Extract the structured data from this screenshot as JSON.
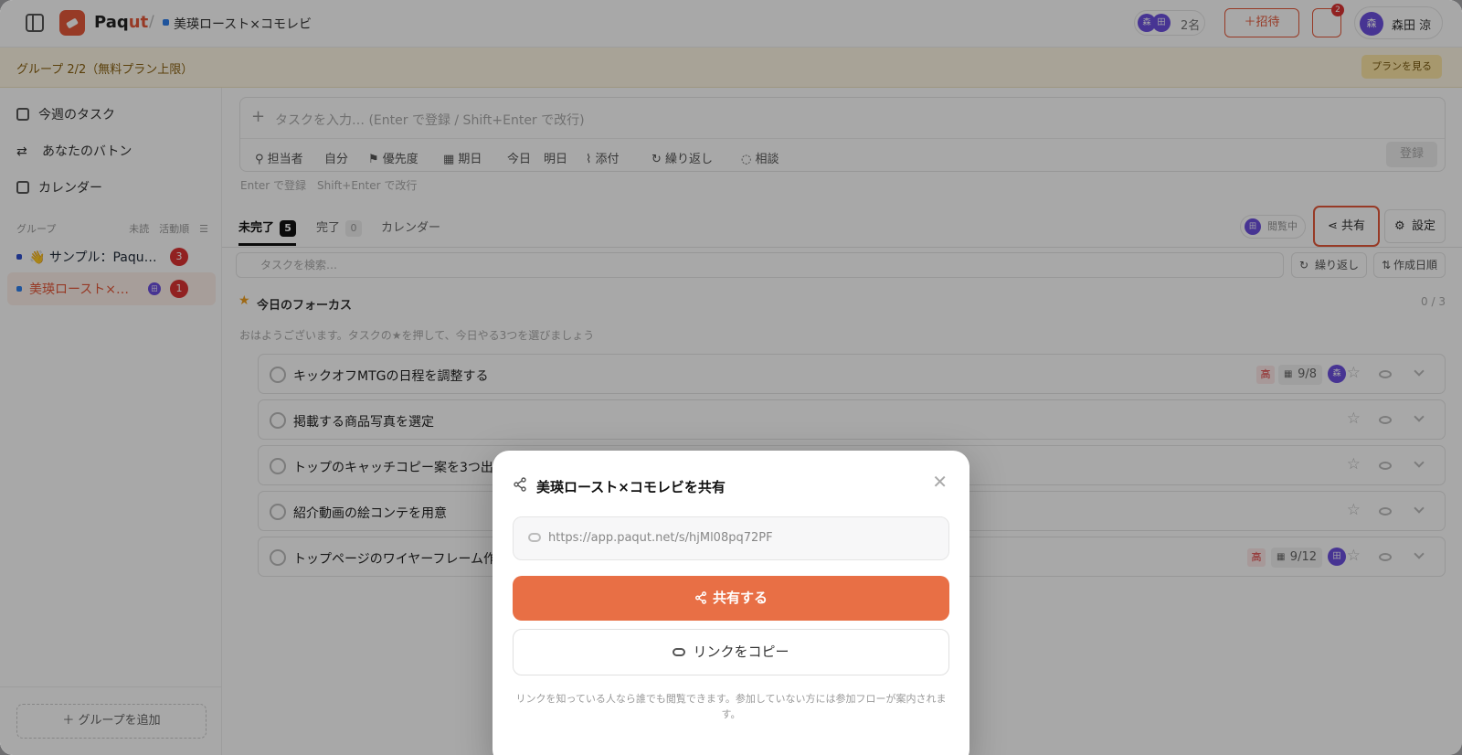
{
  "header": {
    "brand_prefix": "Paq",
    "brand_suffix": "ut",
    "breadcrumb": "美瑛ロースト×コモレビ",
    "member_avatars": [
      "森",
      "田"
    ],
    "member_count": "2名",
    "invite_label": "＋招待",
    "notification_count": "2",
    "user_avatar": "森",
    "user_name": "森田 涼"
  },
  "banner": {
    "text": "グループ 2/2（無料プラン上限）",
    "button": "プランを見る"
  },
  "sidebar": {
    "nav": [
      "今週のタスク",
      "あなたのバトン",
      "カレンダー"
    ],
    "group_header": "グループ",
    "group_header_right": [
      "未読",
      "活動順"
    ],
    "groups": [
      {
        "label": "👋 サンプル：Paqu…",
        "badge": "3",
        "color": "#2f4fcf"
      },
      {
        "label": "美瑛ロースト×…",
        "badge": "1",
        "avatar": "田",
        "color": "#2f80ed"
      }
    ],
    "add_group": "＋ グループを追加"
  },
  "composer": {
    "placeholder": "タスクを入力… (Enter で登録 / Shift+Enter で改行)",
    "tools": [
      "担当者",
      "自分",
      "優先度",
      "期日",
      "今日",
      "明日",
      "添付",
      "繰り返し",
      "相談"
    ],
    "register": "登録",
    "hint": "Enter で登録　Shift+Enter で改行"
  },
  "tabs": [
    {
      "label": "未完了",
      "count": "5"
    },
    {
      "label": "完了",
      "count": "0"
    },
    {
      "label": "カレンダー",
      "count": ""
    }
  ],
  "toolbar": {
    "viewing": "閲覧中",
    "viewing_avatar": "田",
    "share": "共有",
    "settings": "設定",
    "search_placeholder": "タスクを検索…",
    "repeat": "繰り返し",
    "sort": "作成日順"
  },
  "focus": {
    "title": "今日のフォーカス",
    "count": "0 / 3",
    "greeting": "おはようございます。タスクの★を押して、今日やる3つを選びましょう"
  },
  "tasks": [
    {
      "title": "キックオフMTGの日程を調整する",
      "priority": "高",
      "due": "9/8",
      "avatar": "森"
    },
    {
      "title": "掲載する商品写真を選定"
    },
    {
      "title": "トップのキャッチコピー案を3つ出"
    },
    {
      "title": "紹介動画の絵コンテを用意"
    },
    {
      "title": "トップページのワイヤーフレーム作",
      "priority": "高",
      "due": "9/12",
      "avatar": "田"
    }
  ],
  "modal": {
    "title": "美瑛ロースト×コモレビを共有",
    "url": "https://app.paqut.net/s/hjMl08pq72PF",
    "share_button": "共有する",
    "copy_button": "リンクをコピー",
    "note": "リンクを知っている人なら誰でも閲覧できます。参加していない方には参加フローが案内されます。"
  }
}
